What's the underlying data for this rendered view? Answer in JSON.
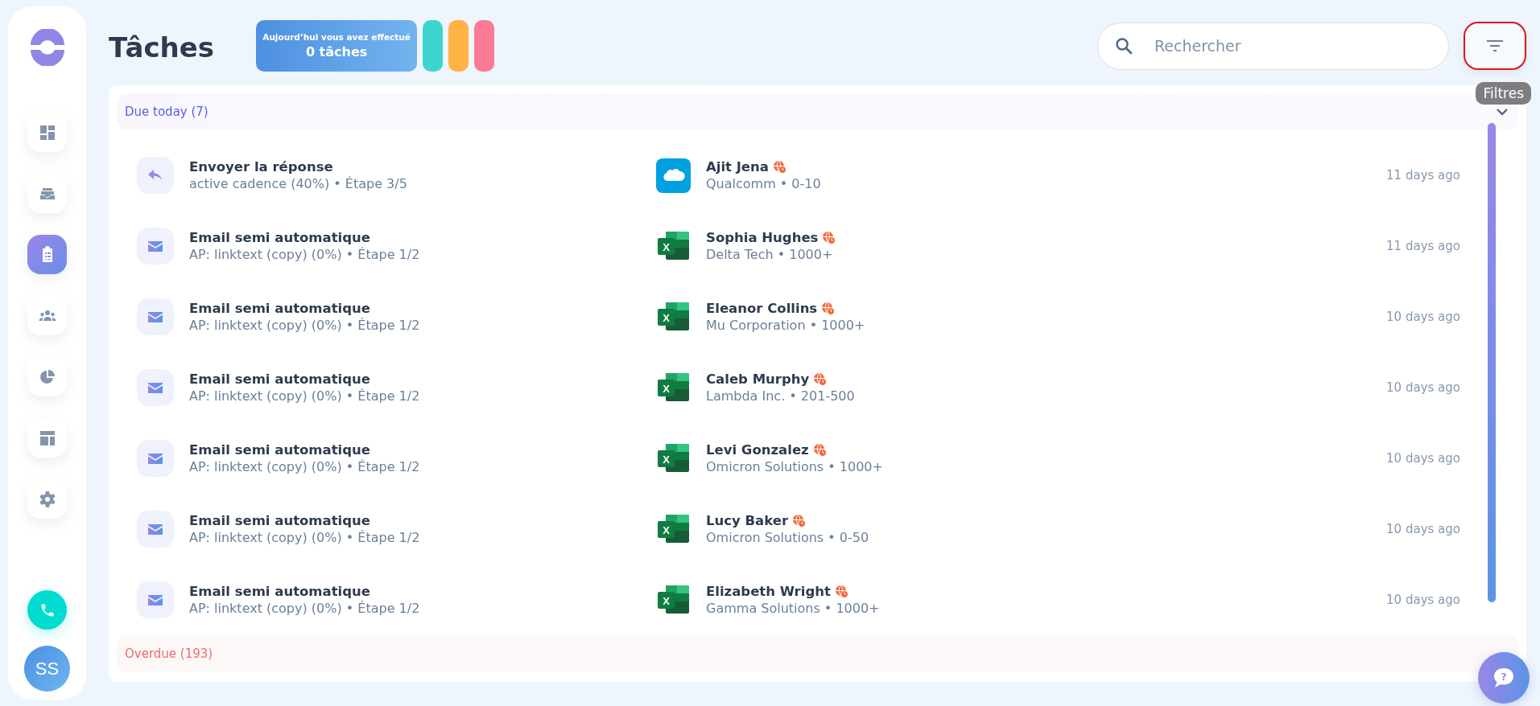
{
  "sidebar": {
    "items": [
      {
        "kind": "dashboard",
        "selected": false
      },
      {
        "kind": "inbox",
        "selected": false
      },
      {
        "kind": "tasks",
        "selected": true
      },
      {
        "kind": "people",
        "selected": false
      },
      {
        "kind": "reports",
        "selected": false
      },
      {
        "kind": "layout",
        "selected": false
      },
      {
        "kind": "settings",
        "selected": false
      }
    ],
    "avatar": "SS"
  },
  "header": {
    "title": "Tâches",
    "stats": {
      "caption": "Aujourd’hui vous avez effectué",
      "count": "0 tâches"
    },
    "stat_pills": [
      {
        "color": "#3dd6cf"
      },
      {
        "color": "#ffb347"
      },
      {
        "color": "#fb7a94"
      }
    ],
    "search": {
      "placeholder": "Rechercher"
    },
    "filter_tooltip": "Filtres"
  },
  "sections": [
    {
      "title": "Due today (7)",
      "kind": "due",
      "expanded": true,
      "tasks": [
        {
          "kind": "reply",
          "title": "Envoyer la réponse",
          "subtitle": "active cadence (40%) • Étape 3/5",
          "source": {
            "kind": "salesforce"
          },
          "contact": "Ajit Jena",
          "company": "Qualcomm • 0-10",
          "time": "11 days ago"
        },
        {
          "kind": "email",
          "title": "Email semi automatique",
          "subtitle": "AP: linktext (copy) (0%) • Étape 1/2",
          "source": {
            "kind": "excel",
            "letter": "X"
          },
          "contact": "Sophia Hughes",
          "company": "Delta Tech • 1000+",
          "time": "11 days ago"
        },
        {
          "kind": "email",
          "title": "Email semi automatique",
          "subtitle": "AP: linktext (copy) (0%) • Étape 1/2",
          "source": {
            "kind": "excel",
            "letter": "X"
          },
          "contact": "Eleanor Collins",
          "company": "Mu Corporation • 1000+",
          "time": "10 days ago"
        },
        {
          "kind": "email",
          "title": "Email semi automatique",
          "subtitle": "AP: linktext (copy) (0%) • Étape 1/2",
          "source": {
            "kind": "excel",
            "letter": "X"
          },
          "contact": "Caleb Murphy",
          "company": "Lambda Inc. • 201-500",
          "time": "10 days ago"
        },
        {
          "kind": "email",
          "title": "Email semi automatique",
          "subtitle": "AP: linktext (copy) (0%) • Étape 1/2",
          "source": {
            "kind": "excel",
            "letter": "X"
          },
          "contact": "Levi Gonzalez",
          "company": "Omicron Solutions • 1000+",
          "time": "10 days ago"
        },
        {
          "kind": "email",
          "title": "Email semi automatique",
          "subtitle": "AP: linktext (copy) (0%) • Étape 1/2",
          "source": {
            "kind": "excel",
            "letter": "X"
          },
          "contact": "Lucy Baker",
          "company": "Omicron Solutions • 0-50",
          "time": "10 days ago"
        },
        {
          "kind": "email",
          "title": "Email semi automatique",
          "subtitle": "AP: linktext (copy) (0%) • Étape 1/2",
          "source": {
            "kind": "excel",
            "letter": "X"
          },
          "contact": "Elizabeth Wright",
          "company": "Gamma Solutions • 1000+",
          "time": "10 days ago"
        }
      ]
    },
    {
      "title": "Overdue (193)",
      "kind": "overdue",
      "expanded": false
    }
  ],
  "help_button": {
    "label": "?"
  }
}
